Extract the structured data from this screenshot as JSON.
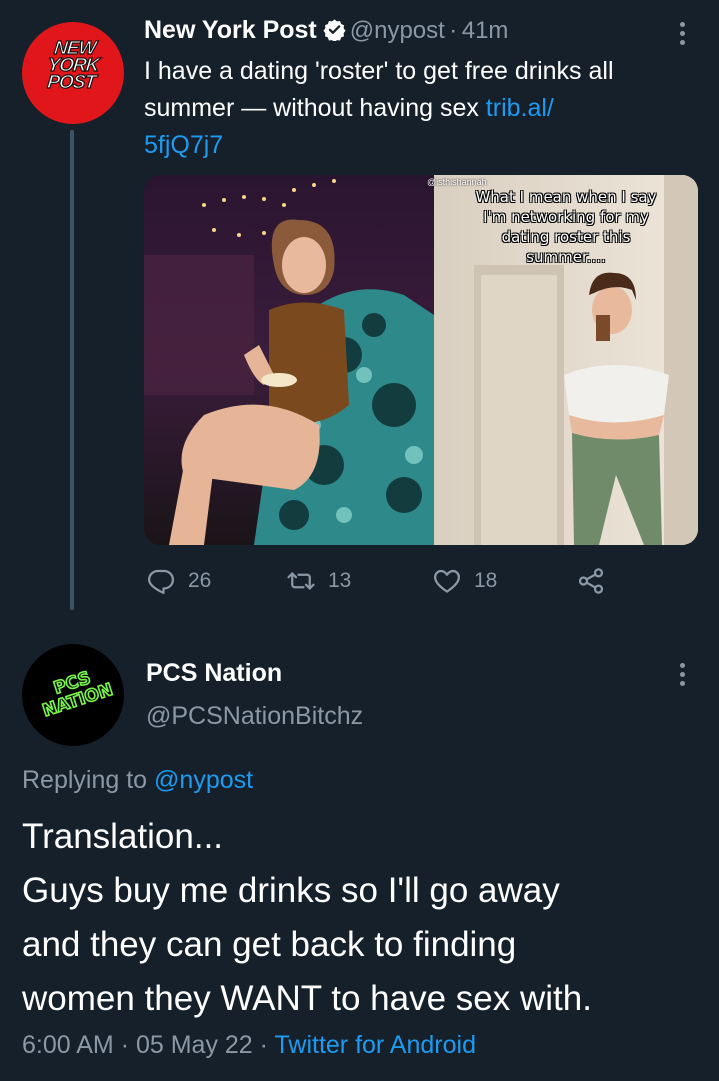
{
  "tweet": {
    "author_name": "New York Post",
    "author_handle": "@nypost",
    "separator": "·",
    "time": "41m",
    "avatar_text": [
      "NEW",
      "YORK",
      "POST"
    ],
    "text_line1": "I have a dating 'roster' to get free drinks all",
    "text_line2_plain": "summer — without having sex ",
    "link_part1": "trib.al/",
    "link_part2": "5fjQ7j7",
    "media_watermark": "@isthishannah",
    "media_caption": [
      "What I mean when I say",
      "I'm networking for my",
      "dating roster this",
      "summer...."
    ],
    "actions": {
      "replies": "26",
      "retweets": "13",
      "likes": "18"
    }
  },
  "reply": {
    "author_name": "PCS Nation",
    "author_handle": "@PCSNationBitchz",
    "avatar_text": [
      "PCS",
      "NATION"
    ],
    "replying_to_label": "Replying to ",
    "replying_to_handle": "@nypost",
    "body_lines": [
      "Translation...",
      "Guys buy me drinks so I'll go away",
      "and they can get back to finding",
      "women they WANT to have sex with."
    ],
    "time": "6:00 AM",
    "sep1": "·",
    "date": "05 May 22",
    "sep2": "·",
    "client": "Twitter for Android"
  },
  "colors": {
    "background": "#15202b",
    "link": "#1d9bf0",
    "muted": "#8b98a5",
    "nypost_red": "#e0161b",
    "pcs_green": "#79f54a"
  }
}
